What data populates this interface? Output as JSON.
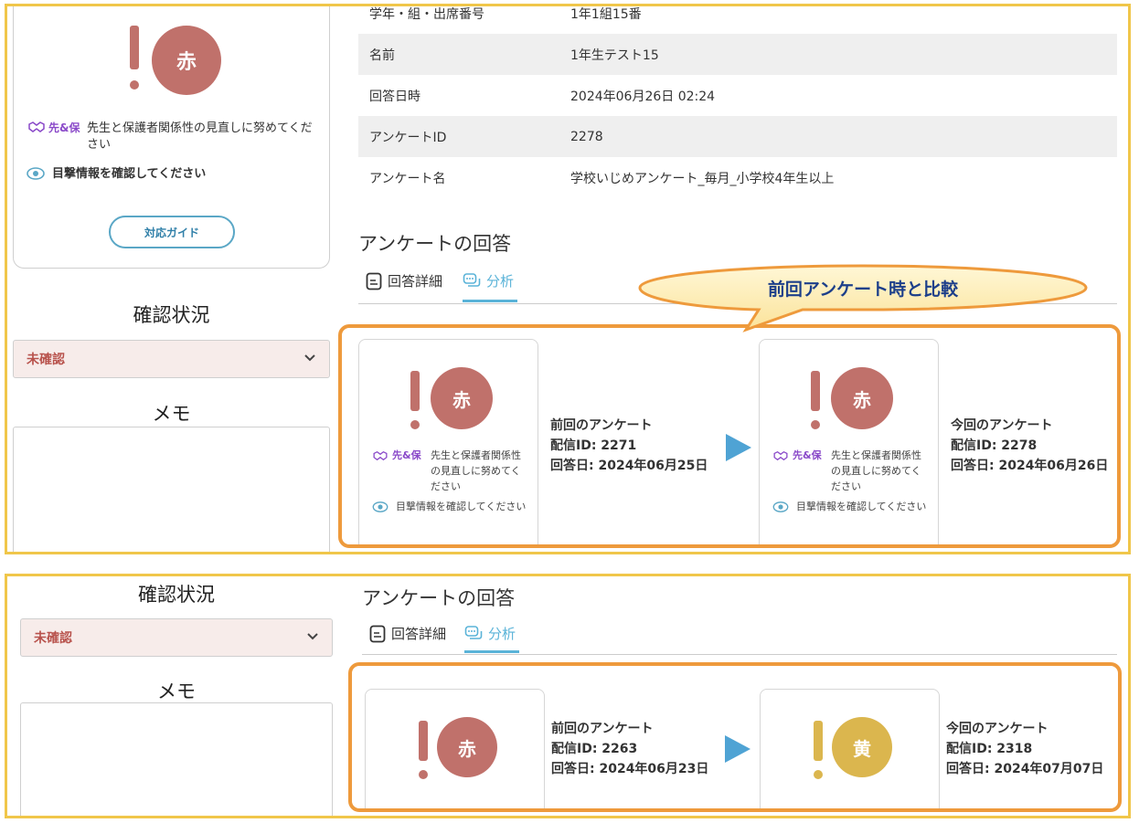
{
  "top": {
    "result": {
      "level": "赤",
      "advice_tag": "先&保",
      "advice_1": "先生と保護者関係性の見直しに努めてください",
      "advice_2": "目撃情報を確認してください",
      "guide_button": "対応ガイド"
    },
    "status_label": "確認状況",
    "status_value": "未確認",
    "memo_label": "メモ",
    "info_rows": [
      {
        "key": "学年・組・出席番号",
        "value": "1年1組15番"
      },
      {
        "key": "名前",
        "value": "1年生テスト15"
      },
      {
        "key": "回答日時",
        "value": "2024年06月26日 02:24"
      },
      {
        "key": "アンケートID",
        "value": "2278"
      },
      {
        "key": "アンケート名",
        "value": "学校いじめアンケート_毎月_小学校4年生以上"
      }
    ],
    "section_title": "アンケートの回答",
    "tabs": {
      "detail": "回答詳細",
      "analysis": "分析"
    },
    "callout": "前回アンケート時と比較",
    "previous": {
      "level": "赤",
      "tag": "先&保",
      "advice_1": "先生と保護者関係性の見直しに努めてください",
      "advice_2": "目撃情報を確認してください",
      "title": "前回のアンケート",
      "id_line": "配信ID: 2271",
      "date_line": "回答日: 2024年06月25日"
    },
    "current": {
      "level": "赤",
      "tag": "先&保",
      "advice_1": "先生と保護者関係性の見直しに努めてください",
      "advice_2": "目撃情報を確認してください",
      "title": "今回のアンケート",
      "id_line": "配信ID: 2278",
      "date_line": "回答日: 2024年06月26日"
    }
  },
  "bottom": {
    "status_label": "確認状況",
    "status_value": "未確認",
    "memo_label": "メモ",
    "section_title": "アンケートの回答",
    "tabs": {
      "detail": "回答詳細",
      "analysis": "分析"
    },
    "previous": {
      "level": "赤",
      "title": "前回のアンケート",
      "id_line": "配信ID: 2263",
      "date_line": "回答日: 2024年06月23日"
    },
    "current": {
      "level": "黄",
      "title": "今回のアンケート",
      "id_line": "配信ID: 2318",
      "date_line": "回答日: 2024年07月07日"
    }
  },
  "colors": {
    "red_level": "#c0716b",
    "yellow_level": "#dbb64e",
    "accent_blue": "#5ab3d8",
    "highlight_orange": "#ee9a3c",
    "panel_border": "#f0c64a"
  }
}
